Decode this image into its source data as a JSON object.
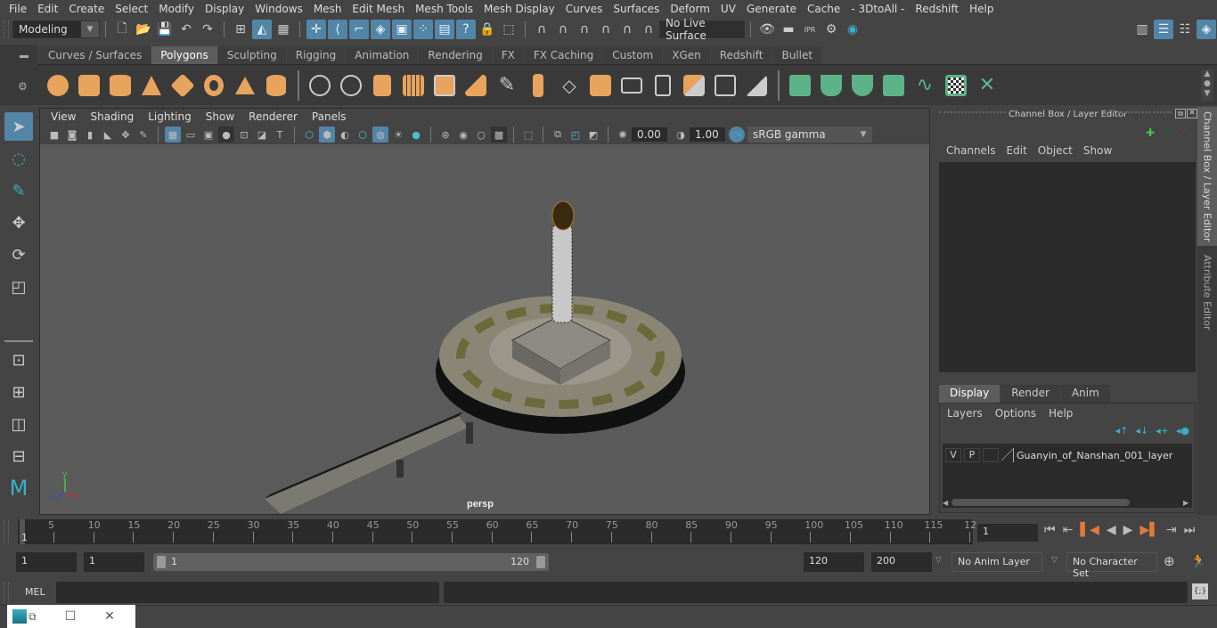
{
  "menubar": [
    "File",
    "Edit",
    "Create",
    "Select",
    "Modify",
    "Display",
    "Windows",
    "Mesh",
    "Edit Mesh",
    "Mesh Tools",
    "Mesh Display",
    "Curves",
    "Surfaces",
    "Deform",
    "UV",
    "Generate",
    "Cache",
    "- 3DtoAll -",
    "Redshift",
    "Help"
  ],
  "status": {
    "mode": "Modeling",
    "live_surface": "No Live Surface"
  },
  "shelf": {
    "tabs": [
      "Curves / Surfaces",
      "Polygons",
      "Sculpting",
      "Rigging",
      "Animation",
      "Rendering",
      "FX",
      "FX Caching",
      "Custom",
      "XGen",
      "Redshift",
      "Bullet"
    ],
    "active_tab": "Polygons",
    "icons": [
      "poly-sphere",
      "poly-cube",
      "poly-cylinder",
      "poly-cone",
      "poly-plane",
      "poly-torus",
      "poly-pyramid",
      "poly-pipe",
      "combine",
      "separate",
      "mirror",
      "smooth",
      "extract",
      "bevel",
      "multi-cut",
      "bridge",
      "extrude",
      "append",
      "insert-edge-loop",
      "offset-edge-loop",
      "weld",
      "fill-hole",
      "target-weld",
      "uv-planar",
      "uv-cylindrical",
      "uv-spherical",
      "uv-automatic",
      "uv-contour",
      "uv-editor",
      "uv-unfold"
    ]
  },
  "viewport": {
    "menus": [
      "View",
      "Shading",
      "Lighting",
      "Show",
      "Renderer",
      "Panels"
    ],
    "exposure": "0.00",
    "gamma": "1.00",
    "color_space": "sRGB gamma",
    "camera_label": "persp",
    "axis": {
      "x": "x",
      "y": "y",
      "z": "z"
    }
  },
  "channel_box": {
    "title": "Channel Box / Layer Editor",
    "menus": [
      "Channels",
      "Edit",
      "Object",
      "Show"
    ],
    "layer_tabs": [
      "Display",
      "Render",
      "Anim"
    ],
    "active_layer_tab": "Display",
    "layer_menus": [
      "Layers",
      "Options",
      "Help"
    ],
    "layers": [
      {
        "v": "V",
        "p": "P",
        "name": "Guanyin_of_Nanshan_001_layer"
      }
    ],
    "side_tabs": [
      "Channel Box / Layer Editor",
      "Attribute Editor"
    ]
  },
  "timeline": {
    "start_marker": "1",
    "ticks": [
      "5",
      "10",
      "15",
      "20",
      "25",
      "30",
      "35",
      "40",
      "45",
      "50",
      "55",
      "60",
      "65",
      "70",
      "75",
      "80",
      "85",
      "90",
      "95",
      "100",
      "105",
      "110",
      "115",
      "12"
    ],
    "current_frame": "1"
  },
  "range": {
    "start": "1",
    "anim_start": "1",
    "slider_start": "1",
    "slider_end": "120",
    "anim_end": "120",
    "end": "200",
    "anim_layer": "No Anim Layer",
    "character_set": "No Character Set"
  },
  "command": {
    "label": "MEL"
  },
  "colors": {
    "accent": "#5285a6",
    "shelf_orange": "#e8a35c",
    "shelf_green": "#5db389",
    "key_orange": "#e07a3a"
  }
}
